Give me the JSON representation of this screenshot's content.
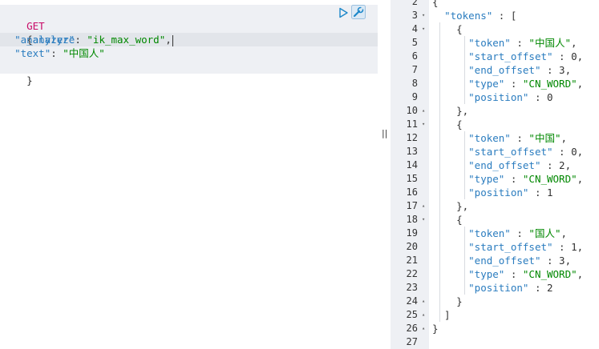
{
  "request": {
    "method": "GET",
    "endpoint": "_analyze",
    "lines": [
      {
        "type": "open",
        "text": "{"
      },
      {
        "type": "kv",
        "key": "\"analyzer\"",
        "sep": ": ",
        "value": "\"ik_max_word\"",
        "tail": ","
      },
      {
        "type": "kv",
        "key": "\"text\"",
        "sep": ": ",
        "value": "\"中国人\"",
        "tail": ""
      },
      {
        "type": "close",
        "text": "}"
      }
    ]
  },
  "response": {
    "lines": [
      {
        "n": "2",
        "fold": "",
        "parts": [
          {
            "t": "p",
            "v": "{"
          }
        ]
      },
      {
        "n": "3",
        "fold": "▾",
        "parts": [
          {
            "t": "p",
            "v": "  "
          },
          {
            "t": "k",
            "v": "\"tokens\""
          },
          {
            "t": "p",
            "v": " : ["
          }
        ]
      },
      {
        "n": "4",
        "fold": "▾",
        "parts": [
          {
            "t": "p",
            "v": "    {"
          }
        ]
      },
      {
        "n": "5",
        "fold": "",
        "parts": [
          {
            "t": "p",
            "v": "      "
          },
          {
            "t": "k",
            "v": "\"token\""
          },
          {
            "t": "p",
            "v": " : "
          },
          {
            "t": "s",
            "v": "\"中国人\""
          },
          {
            "t": "p",
            "v": ","
          }
        ]
      },
      {
        "n": "6",
        "fold": "",
        "parts": [
          {
            "t": "p",
            "v": "      "
          },
          {
            "t": "k",
            "v": "\"start_offset\""
          },
          {
            "t": "p",
            "v": " : 0,"
          }
        ]
      },
      {
        "n": "7",
        "fold": "",
        "parts": [
          {
            "t": "p",
            "v": "      "
          },
          {
            "t": "k",
            "v": "\"end_offset\""
          },
          {
            "t": "p",
            "v": " : 3,"
          }
        ]
      },
      {
        "n": "8",
        "fold": "",
        "parts": [
          {
            "t": "p",
            "v": "      "
          },
          {
            "t": "k",
            "v": "\"type\""
          },
          {
            "t": "p",
            "v": " : "
          },
          {
            "t": "s",
            "v": "\"CN_WORD\""
          },
          {
            "t": "p",
            "v": ","
          }
        ]
      },
      {
        "n": "9",
        "fold": "",
        "parts": [
          {
            "t": "p",
            "v": "      "
          },
          {
            "t": "k",
            "v": "\"position\""
          },
          {
            "t": "p",
            "v": " : 0"
          }
        ]
      },
      {
        "n": "10",
        "fold": "▴",
        "parts": [
          {
            "t": "p",
            "v": "    },"
          }
        ]
      },
      {
        "n": "11",
        "fold": "▾",
        "parts": [
          {
            "t": "p",
            "v": "    {"
          }
        ]
      },
      {
        "n": "12",
        "fold": "",
        "parts": [
          {
            "t": "p",
            "v": "      "
          },
          {
            "t": "k",
            "v": "\"token\""
          },
          {
            "t": "p",
            "v": " : "
          },
          {
            "t": "s",
            "v": "\"中国\""
          },
          {
            "t": "p",
            "v": ","
          }
        ]
      },
      {
        "n": "13",
        "fold": "",
        "parts": [
          {
            "t": "p",
            "v": "      "
          },
          {
            "t": "k",
            "v": "\"start_offset\""
          },
          {
            "t": "p",
            "v": " : 0,"
          }
        ]
      },
      {
        "n": "14",
        "fold": "",
        "parts": [
          {
            "t": "p",
            "v": "      "
          },
          {
            "t": "k",
            "v": "\"end_offset\""
          },
          {
            "t": "p",
            "v": " : 2,"
          }
        ]
      },
      {
        "n": "15",
        "fold": "",
        "parts": [
          {
            "t": "p",
            "v": "      "
          },
          {
            "t": "k",
            "v": "\"type\""
          },
          {
            "t": "p",
            "v": " : "
          },
          {
            "t": "s",
            "v": "\"CN_WORD\""
          },
          {
            "t": "p",
            "v": ","
          }
        ]
      },
      {
        "n": "16",
        "fold": "",
        "parts": [
          {
            "t": "p",
            "v": "      "
          },
          {
            "t": "k",
            "v": "\"position\""
          },
          {
            "t": "p",
            "v": " : 1"
          }
        ]
      },
      {
        "n": "17",
        "fold": "▴",
        "parts": [
          {
            "t": "p",
            "v": "    },"
          }
        ]
      },
      {
        "n": "18",
        "fold": "▾",
        "parts": [
          {
            "t": "p",
            "v": "    {"
          }
        ]
      },
      {
        "n": "19",
        "fold": "",
        "parts": [
          {
            "t": "p",
            "v": "      "
          },
          {
            "t": "k",
            "v": "\"token\""
          },
          {
            "t": "p",
            "v": " : "
          },
          {
            "t": "s",
            "v": "\"国人\""
          },
          {
            "t": "p",
            "v": ","
          }
        ]
      },
      {
        "n": "20",
        "fold": "",
        "parts": [
          {
            "t": "p",
            "v": "      "
          },
          {
            "t": "k",
            "v": "\"start_offset\""
          },
          {
            "t": "p",
            "v": " : 1,"
          }
        ]
      },
      {
        "n": "21",
        "fold": "",
        "parts": [
          {
            "t": "p",
            "v": "      "
          },
          {
            "t": "k",
            "v": "\"end_offset\""
          },
          {
            "t": "p",
            "v": " : 3,"
          }
        ]
      },
      {
        "n": "22",
        "fold": "",
        "parts": [
          {
            "t": "p",
            "v": "      "
          },
          {
            "t": "k",
            "v": "\"type\""
          },
          {
            "t": "p",
            "v": " : "
          },
          {
            "t": "s",
            "v": "\"CN_WORD\""
          },
          {
            "t": "p",
            "v": ","
          }
        ]
      },
      {
        "n": "23",
        "fold": "",
        "parts": [
          {
            "t": "p",
            "v": "      "
          },
          {
            "t": "k",
            "v": "\"position\""
          },
          {
            "t": "p",
            "v": " : 2"
          }
        ]
      },
      {
        "n": "24",
        "fold": "▴",
        "parts": [
          {
            "t": "p",
            "v": "    }"
          }
        ]
      },
      {
        "n": "25",
        "fold": "▴",
        "parts": [
          {
            "t": "p",
            "v": "  ]"
          }
        ]
      },
      {
        "n": "26",
        "fold": "▴",
        "parts": [
          {
            "t": "p",
            "v": "}"
          }
        ]
      },
      {
        "n": "27",
        "fold": "",
        "parts": []
      }
    ]
  },
  "icons": {
    "run": "play-icon",
    "settings": "wrench-icon",
    "splitter": "resize-handle-icon"
  },
  "colors": {
    "method": "#c80a68",
    "key": "#2a7cbf",
    "string": "#008800",
    "gutter_bg": "#eef0f4",
    "request_bg": "#eef0f4",
    "accent": "#1c87c9"
  }
}
